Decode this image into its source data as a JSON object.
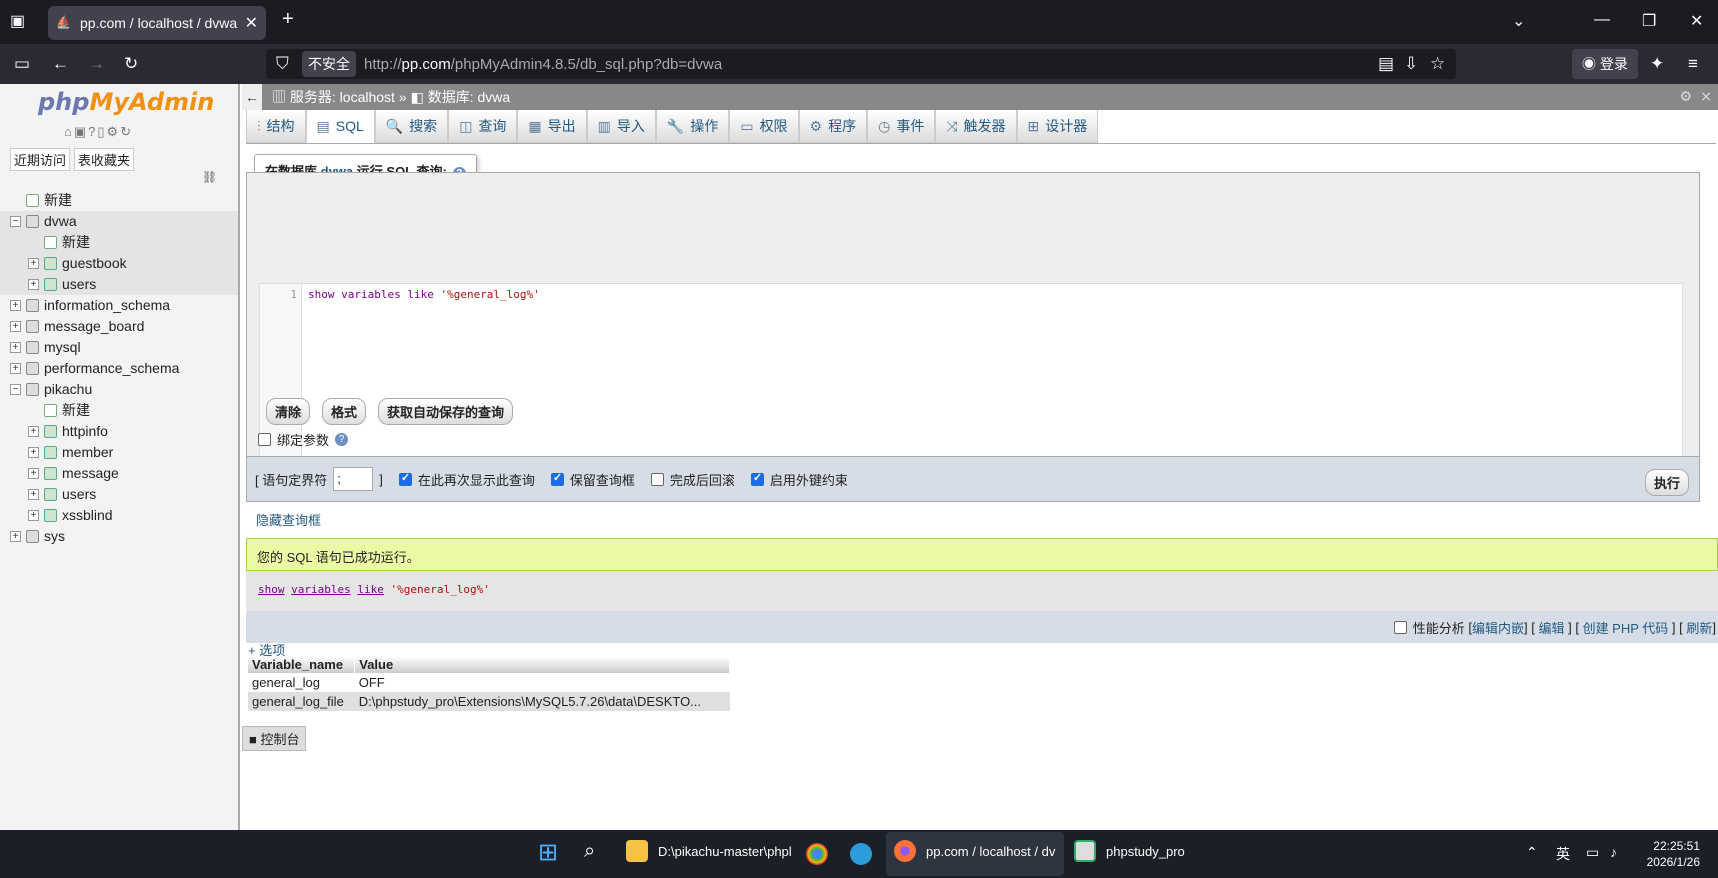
{
  "browser": {
    "tab_title": "pp.com / localhost / dvwa | p",
    "insecure_label": "不安全",
    "url_prefix": "http://",
    "url_host": "pp.com",
    "url_path": "/phpMyAdmin4.8.5/db_sql.php?db=dvwa",
    "login_label": "登录"
  },
  "sidebar": {
    "logo_php": "php",
    "logo_myadmin": "MyAdmin",
    "tab_recent": "近期访问",
    "tab_favorites": "表收藏夹",
    "tree": [
      {
        "label": "新建",
        "level": 0,
        "kind": "new",
        "expander": "",
        "hl": false
      },
      {
        "label": "dvwa",
        "level": 0,
        "kind": "db",
        "expander": "−",
        "hl": true
      },
      {
        "label": "新建",
        "level": 1,
        "kind": "new",
        "expander": "",
        "hl": true
      },
      {
        "label": "guestbook",
        "level": 1,
        "kind": "table",
        "expander": "+",
        "hl": true
      },
      {
        "label": "users",
        "level": 1,
        "kind": "table",
        "expander": "+",
        "hl": true
      },
      {
        "label": "information_schema",
        "level": 0,
        "kind": "db",
        "expander": "+",
        "hl": false
      },
      {
        "label": "message_board",
        "level": 0,
        "kind": "db",
        "expander": "+",
        "hl": false
      },
      {
        "label": "mysql",
        "level": 0,
        "kind": "db",
        "expander": "+",
        "hl": false
      },
      {
        "label": "performance_schema",
        "level": 0,
        "kind": "db",
        "expander": "+",
        "hl": false
      },
      {
        "label": "pikachu",
        "level": 0,
        "kind": "db",
        "expander": "−",
        "hl": false
      },
      {
        "label": "新建",
        "level": 1,
        "kind": "new",
        "expander": "",
        "hl": false
      },
      {
        "label": "httpinfo",
        "level": 1,
        "kind": "table",
        "expander": "+",
        "hl": false
      },
      {
        "label": "member",
        "level": 1,
        "kind": "table",
        "expander": "+",
        "hl": false
      },
      {
        "label": "message",
        "level": 1,
        "kind": "table",
        "expander": "+",
        "hl": false
      },
      {
        "label": "users",
        "level": 1,
        "kind": "table",
        "expander": "+",
        "hl": false
      },
      {
        "label": "xssblind",
        "level": 1,
        "kind": "table",
        "expander": "+",
        "hl": false
      },
      {
        "label": "sys",
        "level": 0,
        "kind": "db",
        "expander": "+",
        "hl": false
      }
    ]
  },
  "breadcrumb": {
    "server": "服务器: localhost »",
    "database": "数据库: dvwa"
  },
  "menu_tabs": [
    "结构",
    "SQL",
    "搜索",
    "查询",
    "导出",
    "导入",
    "操作",
    "权限",
    "程序",
    "事件",
    "触发器",
    "设计器"
  ],
  "query_box": {
    "legend_prefix": "在数据库",
    "legend_db": "dvwa",
    "legend_suffix": "运行 SQL 查询:",
    "line_number": "1",
    "code_kw": "show variables like ",
    "code_str": "'%general_log%'",
    "btn_clear": "清除",
    "btn_format": "格式",
    "btn_autosave": "获取自动保存的查询",
    "bind_params": "绑定参数"
  },
  "options_bar": {
    "delimiter_label_open": "[ 语句定界符",
    "delimiter_value": ";",
    "delimiter_label_close": "]",
    "opt_show_again": "在此再次显示此查询",
    "opt_keep_box": "保留查询框",
    "opt_rollback": "完成后回滚",
    "opt_fk": "启用外键约束",
    "execute": "执行"
  },
  "hide_query_box": "隐藏查询框",
  "result": {
    "success_message": "您的 SQL 语句已成功运行。",
    "sql_show": "show",
    "sql_variables": "variables",
    "sql_like": "like",
    "sql_str": "'%general_log%'",
    "profiling": "性能分析",
    "edit_inline": "编辑内嵌",
    "edit": "编辑",
    "create_php": "创建 PHP 代码",
    "refresh": "刷新",
    "options": "+ 选项",
    "col_name": "Variable_name",
    "col_value": "Value",
    "rows": [
      {
        "name": "general_log",
        "value": "OFF"
      },
      {
        "name": "general_log_file",
        "value": "D:\\phpstudy_pro\\Extensions\\MySQL5.7.26\\data\\DESKTO..."
      }
    ]
  },
  "console_label": "控制台",
  "taskbar": {
    "explorer_label": "D:\\pikachu-master\\phpl",
    "firefox_label": "pp.com / localhost / dv",
    "phpstudy_label": "phpstudy_pro",
    "ime": "英",
    "time": "22:25:51",
    "date": "2026/1/26"
  }
}
